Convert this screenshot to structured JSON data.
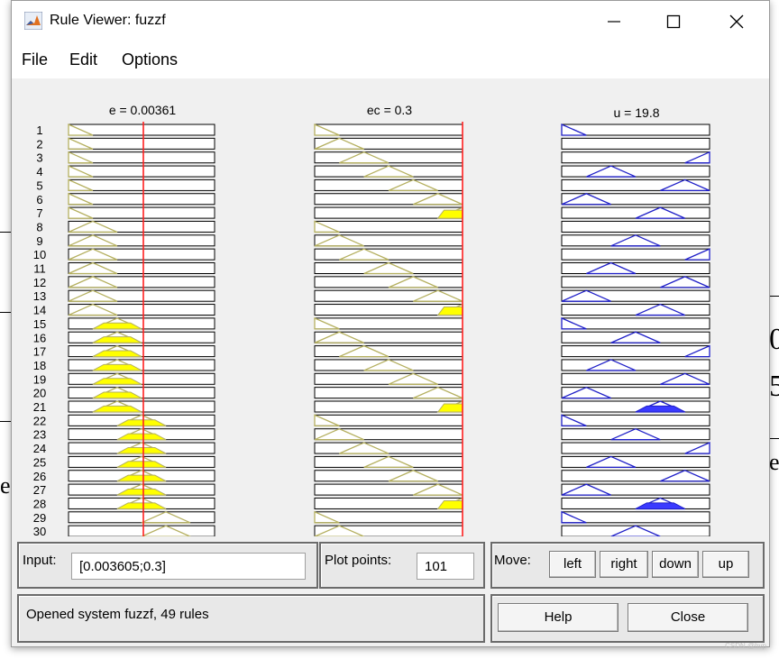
{
  "window": {
    "title": "Rule Viewer: fuzzf",
    "controls": {
      "minimize": "—",
      "maximize": "☐",
      "close": "✕"
    }
  },
  "menu": [
    "File",
    "Edit",
    "Options"
  ],
  "plots": {
    "e_label": "e = 0.00361",
    "ec_label": "ec = 0.3",
    "u_label": "u = 19.8",
    "visible_rule_numbers": [
      "1",
      "2",
      "3",
      "4",
      "5",
      "6",
      "7",
      "8",
      "9",
      "10",
      "11",
      "12",
      "13",
      "14",
      "15",
      "16",
      "17",
      "18",
      "19",
      "20",
      "21",
      "22",
      "23",
      "24",
      "25",
      "26",
      "27",
      "28",
      "29",
      "30"
    ],
    "colors": {
      "input_mf": "#b5b060",
      "input_fill": "#ffff00",
      "output_mf": "#2020c8",
      "output_fill": "#3a3aff",
      "indicator": "#ff2020"
    }
  },
  "input": {
    "label": "Input:",
    "value": "[0.003605;0.3]",
    "plot_points_label": "Plot points:",
    "plot_points_value": "101"
  },
  "move": {
    "label": "Move:",
    "buttons": [
      "left",
      "right",
      "down",
      "up"
    ]
  },
  "status": "Opened system fuzzf, 49 rules",
  "buttons": {
    "help": "Help",
    "close": "Close"
  },
  "watermark": "CSDN @hvp"
}
